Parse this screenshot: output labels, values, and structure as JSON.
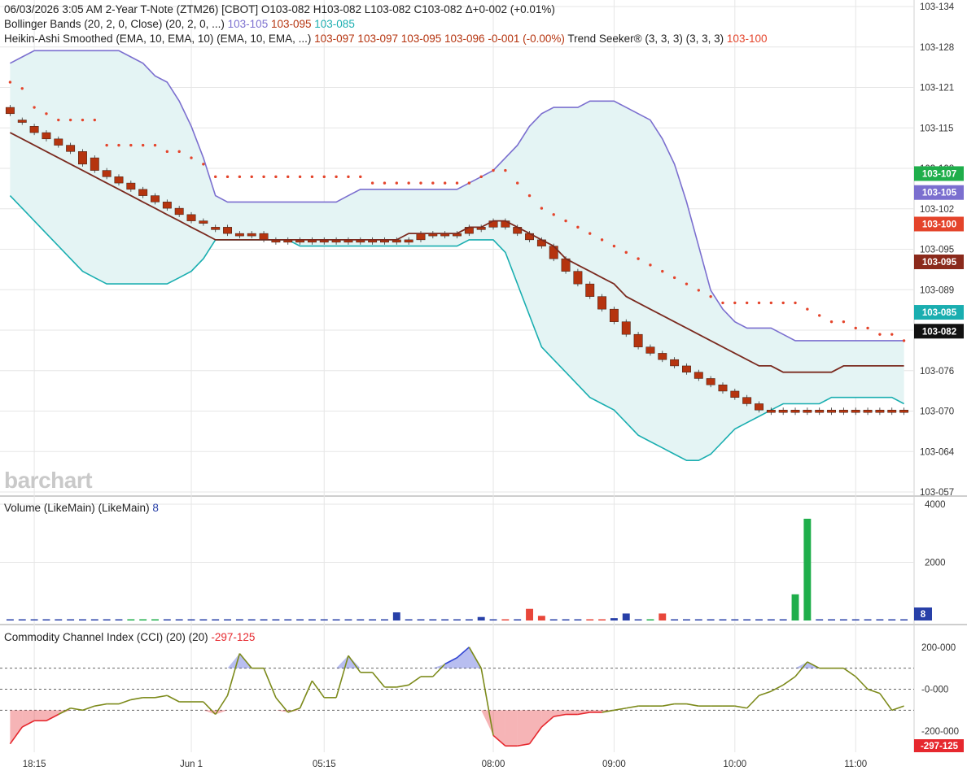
{
  "header": {
    "line1": "06/03/2026  3:05 AM 2-Year T-Note (ZTM26) [CBOT]  O103-082  H103-082  L103-082  C103-082  Δ+0-002 (+0.01%)",
    "line2_label": "Bollinger Bands (20, 2, 0, Close)  (20, 2, 0, ...)",
    "line2_upper": "103-105",
    "line2_mid": "103-095",
    "line2_lower": "103-085",
    "line3_label": "Heikin-Ashi Smoothed (EMA, 10, EMA, 10)  (EMA, 10, EMA, ...)",
    "line3_values": "103-097  103-097  103-095  103-096  -0-001 (-0.00%)",
    "line3_trend_label": "Trend Seeker® (3, 3, 3)  (3, 3, 3)",
    "line3_trend_value": "103-100",
    "volume_label": "Volume (LikeMain)  (LikeMain)",
    "volume_value": "8",
    "cci_label": "Commodity Channel Index (CCI) (20)  (20)",
    "cci_value": "-297-125"
  },
  "watermark": "barchart",
  "colors": {
    "bb_upper": "#7b6fcf",
    "bb_lower": "#1aaeb0",
    "bb_fill": "#e4f4f4",
    "ha_candle": "#b5340f",
    "ha_line": "#7a2a1f",
    "trend_dots": "#e4442b",
    "vol_up": "#1fae4b",
    "vol_down": "#e8463a",
    "vol_neutral": "#2840a8",
    "cci_line": "#7c8a1a",
    "cci_pos": "#3346d3",
    "cci_neg": "#e6282e"
  },
  "chart_data": [
    {
      "type": "line",
      "name_pane": "price",
      "ylim": [
        103.057,
        103.134
      ],
      "y_ticks": [
        "103-134",
        "103-128",
        "103-121",
        "103-115",
        "103-108",
        "103-102",
        "103-095",
        "103-089",
        "103-082",
        "103-076",
        "103-070",
        "103-064",
        "103-057"
      ],
      "x_ticks": [
        {
          "label": "18:15",
          "index": 2
        },
        {
          "label": "Jun 1",
          "index": 15
        },
        {
          "label": "05:15",
          "index": 26
        },
        {
          "label": "08:00",
          "index": 40
        },
        {
          "label": "09:00",
          "index": 50
        },
        {
          "label": "10:00",
          "index": 60
        },
        {
          "label": "11:00",
          "index": 70
        }
      ],
      "n_bars": 75,
      "series": [
        {
          "name": "103-105",
          "role": "bb_upper",
          "values": [
            103.125,
            103.126,
            103.127,
            103.127,
            103.127,
            103.127,
            103.127,
            103.127,
            103.127,
            103.127,
            103.126,
            103.125,
            103.123,
            103.122,
            103.119,
            103.115,
            103.11,
            103.104,
            103.103,
            103.103,
            103.103,
            103.103,
            103.103,
            103.103,
            103.103,
            103.103,
            103.103,
            103.103,
            103.104,
            103.105,
            103.105,
            103.105,
            103.105,
            103.105,
            103.105,
            103.105,
            103.105,
            103.105,
            103.106,
            103.107,
            103.108,
            103.11,
            103.112,
            103.115,
            103.117,
            103.118,
            103.118,
            103.118,
            103.119,
            103.119,
            103.119,
            103.118,
            103.117,
            103.116,
            103.113,
            103.109,
            103.103,
            103.096,
            103.089,
            103.086,
            103.084,
            103.083,
            103.083,
            103.083,
            103.082,
            103.081,
            103.081,
            103.081,
            103.081,
            103.081,
            103.081,
            103.081,
            103.081,
            103.081,
            103.081
          ]
        },
        {
          "name": "103-085",
          "role": "bb_lower",
          "values": [
            103.104,
            103.102,
            103.1,
            103.098,
            103.096,
            103.094,
            103.092,
            103.091,
            103.09,
            103.09,
            103.09,
            103.09,
            103.09,
            103.09,
            103.091,
            103.092,
            103.094,
            103.097,
            103.097,
            103.097,
            103.097,
            103.097,
            103.097,
            103.097,
            103.096,
            103.096,
            103.096,
            103.096,
            103.096,
            103.096,
            103.096,
            103.096,
            103.096,
            103.096,
            103.096,
            103.096,
            103.096,
            103.096,
            103.097,
            103.097,
            103.097,
            103.095,
            103.09,
            103.085,
            103.08,
            103.078,
            103.076,
            103.074,
            103.072,
            103.071,
            103.07,
            103.068,
            103.066,
            103.065,
            103.064,
            103.063,
            103.062,
            103.062,
            103.063,
            103.065,
            103.067,
            103.068,
            103.069,
            103.07,
            103.071,
            103.071,
            103.071,
            103.071,
            103.072,
            103.072,
            103.072,
            103.072,
            103.072,
            103.072,
            103.071
          ]
        },
        {
          "name": "103-095",
          "role": "ha_smoothed",
          "values": [
            103.114,
            103.113,
            103.112,
            103.111,
            103.11,
            103.109,
            103.108,
            103.107,
            103.106,
            103.105,
            103.104,
            103.103,
            103.102,
            103.101,
            103.1,
            103.099,
            103.098,
            103.097,
            103.097,
            103.097,
            103.097,
            103.097,
            103.097,
            103.097,
            103.097,
            103.097,
            103.097,
            103.097,
            103.097,
            103.097,
            103.097,
            103.097,
            103.097,
            103.098,
            103.098,
            103.098,
            103.098,
            103.098,
            103.099,
            103.099,
            103.1,
            103.1,
            103.099,
            103.098,
            103.097,
            103.096,
            103.094,
            103.093,
            103.092,
            103.091,
            103.09,
            103.088,
            103.087,
            103.086,
            103.085,
            103.084,
            103.083,
            103.082,
            103.081,
            103.08,
            103.079,
            103.078,
            103.077,
            103.077,
            103.076,
            103.076,
            103.076,
            103.076,
            103.076,
            103.077,
            103.077,
            103.077,
            103.077,
            103.077,
            103.077
          ]
        },
        {
          "name": "103-100",
          "role": "trend_seeker",
          "values": [
            103.122,
            103.121,
            103.118,
            103.117,
            103.116,
            103.116,
            103.116,
            103.116,
            103.112,
            103.112,
            103.112,
            103.112,
            103.112,
            103.111,
            103.111,
            103.11,
            103.109,
            103.107,
            103.107,
            103.107,
            103.107,
            103.107,
            103.107,
            103.107,
            103.107,
            103.107,
            103.107,
            103.107,
            103.107,
            103.107,
            103.106,
            103.106,
            103.106,
            103.106,
            103.106,
            103.106,
            103.106,
            103.106,
            103.106,
            103.107,
            103.108,
            103.108,
            103.106,
            103.104,
            103.102,
            103.101,
            103.1,
            103.099,
            103.098,
            103.097,
            103.096,
            103.095,
            103.094,
            103.093,
            103.092,
            103.091,
            103.09,
            103.089,
            103.088,
            103.087,
            103.087,
            103.087,
            103.087,
            103.087,
            103.087,
            103.087,
            103.086,
            103.085,
            103.084,
            103.084,
            103.083,
            103.083,
            103.082,
            103.082,
            103.081
          ]
        }
      ],
      "ha_candles": {
        "open": [
          103.118,
          103.116,
          103.115,
          103.114,
          103.113,
          103.112,
          103.111,
          103.11,
          103.108,
          103.107,
          103.106,
          103.105,
          103.104,
          103.103,
          103.102,
          103.101,
          103.1,
          103.099,
          103.099,
          103.098,
          103.098,
          103.098,
          103.097,
          103.097,
          103.097,
          103.097,
          103.097,
          103.097,
          103.097,
          103.097,
          103.097,
          103.097,
          103.097,
          103.097,
          103.097,
          103.098,
          103.098,
          103.098,
          103.098,
          103.099,
          103.099,
          103.1,
          103.099,
          103.098,
          103.097,
          103.096,
          103.094,
          103.092,
          103.09,
          103.088,
          103.086,
          103.084,
          103.082,
          103.08,
          103.079,
          103.078,
          103.077,
          103.076,
          103.075,
          103.074,
          103.073,
          103.072,
          103.071,
          103.07,
          103.07,
          103.07,
          103.07,
          103.07,
          103.07,
          103.07,
          103.07,
          103.07,
          103.07,
          103.07,
          103.07
        ],
        "close": [
          103.117,
          103.116,
          103.114,
          103.113,
          103.112,
          103.111,
          103.109,
          103.108,
          103.107,
          103.106,
          103.105,
          103.104,
          103.103,
          103.102,
          103.101,
          103.1,
          103.1,
          103.099,
          103.098,
          103.098,
          103.098,
          103.097,
          103.097,
          103.097,
          103.097,
          103.097,
          103.097,
          103.097,
          103.097,
          103.097,
          103.097,
          103.097,
          103.097,
          103.097,
          103.098,
          103.098,
          103.098,
          103.098,
          103.099,
          103.099,
          103.1,
          103.099,
          103.098,
          103.097,
          103.096,
          103.094,
          103.092,
          103.09,
          103.088,
          103.086,
          103.084,
          103.082,
          103.08,
          103.079,
          103.078,
          103.077,
          103.076,
          103.075,
          103.074,
          103.073,
          103.072,
          103.071,
          103.07,
          103.07,
          103.07,
          103.07,
          103.07,
          103.07,
          103.07,
          103.07,
          103.07,
          103.07,
          103.07,
          103.07,
          103.07
        ]
      },
      "right_badges": [
        {
          "label": "103-107",
          "value": 103.1075,
          "color": "#1fae4b"
        },
        {
          "label": "103-105",
          "value": 103.1045,
          "color": "#7b6fcf"
        },
        {
          "label": "103-100",
          "value": 103.0995,
          "color": "#e4442b"
        },
        {
          "label": "103-095",
          "value": 103.0935,
          "color": "#8b2a1c"
        },
        {
          "label": "103-085",
          "value": 103.0855,
          "color": "#1aaeb0"
        },
        {
          "label": "103-082",
          "value": 103.0825,
          "color": "#111111"
        }
      ]
    },
    {
      "type": "bar",
      "name_pane": "volume",
      "ylim": [
        0,
        4000
      ],
      "y_ticks": [
        "4000",
        "2000"
      ],
      "series": [
        {
          "name": "8",
          "values": [
            0,
            0,
            0,
            0,
            0,
            0,
            0,
            0,
            15,
            0,
            15,
            15,
            15,
            0,
            0,
            0,
            0,
            0,
            0,
            0,
            0,
            0,
            0,
            40,
            0,
            0,
            0,
            0,
            0,
            0,
            0,
            0,
            280,
            0,
            0,
            0,
            0,
            0,
            0,
            120,
            0,
            40,
            0,
            400,
            160,
            0,
            0,
            0,
            40,
            40,
            80,
            240,
            0,
            40,
            240,
            0,
            0,
            0,
            0,
            0,
            0,
            0,
            0,
            0,
            0,
            0,
            0,
            0,
            0,
            0,
            0,
            0,
            0,
            0,
            0
          ],
          "colors": [
            "n",
            "n",
            "n",
            "n",
            "n",
            "n",
            "n",
            "n",
            "n",
            "n",
            "u",
            "u",
            "u",
            "n",
            "n",
            "n",
            "n",
            "n",
            "n",
            "n",
            "n",
            "n",
            "n",
            "n",
            "n",
            "n",
            "n",
            "n",
            "n",
            "n",
            "n",
            "n",
            "n",
            "n",
            "n",
            "n",
            "n",
            "n",
            "n",
            "n",
            "n",
            "d",
            "n",
            "d",
            "d",
            "n",
            "n",
            "n",
            "d",
            "d",
            "n",
            "n",
            "n",
            "u",
            "d",
            "n",
            "n",
            "n",
            "n",
            "n",
            "n",
            "n",
            "n",
            "n",
            "n",
            "n",
            "n",
            "n",
            "n",
            "n",
            "n",
            "n",
            "n",
            "n",
            "n"
          ]
        }
      ],
      "spikes": [
        {
          "index": 65,
          "value": 900,
          "color": "u"
        },
        {
          "index": 66,
          "value": 3500,
          "color": "u"
        }
      ],
      "right_badge": {
        "label": "8",
        "color": "#2840a8"
      }
    },
    {
      "type": "line",
      "name_pane": "cci",
      "ylim": [
        -300,
        300
      ],
      "y_ticks": [
        "200-000",
        "-0-000",
        "-200-000"
      ],
      "ref_lines": [
        100,
        0,
        -100
      ],
      "series": [
        {
          "name": "-297-125",
          "values": [
            -260,
            -180,
            -150,
            -150,
            -120,
            -90,
            -100,
            -80,
            -70,
            -70,
            -50,
            -40,
            -40,
            -30,
            -60,
            -60,
            -60,
            -120,
            -30,
            170,
            100,
            100,
            -40,
            -110,
            -90,
            40,
            -40,
            -40,
            160,
            80,
            80,
            10,
            10,
            20,
            60,
            60,
            120,
            150,
            200,
            100,
            -220,
            -270,
            -270,
            -260,
            -180,
            -130,
            -120,
            -120,
            -110,
            -110,
            -100,
            -90,
            -80,
            -80,
            -80,
            -70,
            -70,
            -80,
            -80,
            -80,
            -80,
            -90,
            -30,
            -10,
            20,
            60,
            130,
            100,
            100,
            100,
            60,
            0,
            -20,
            -100,
            -80
          ]
        }
      ],
      "right_badge": {
        "label": "-297-125",
        "color": "#e6282e"
      }
    }
  ]
}
